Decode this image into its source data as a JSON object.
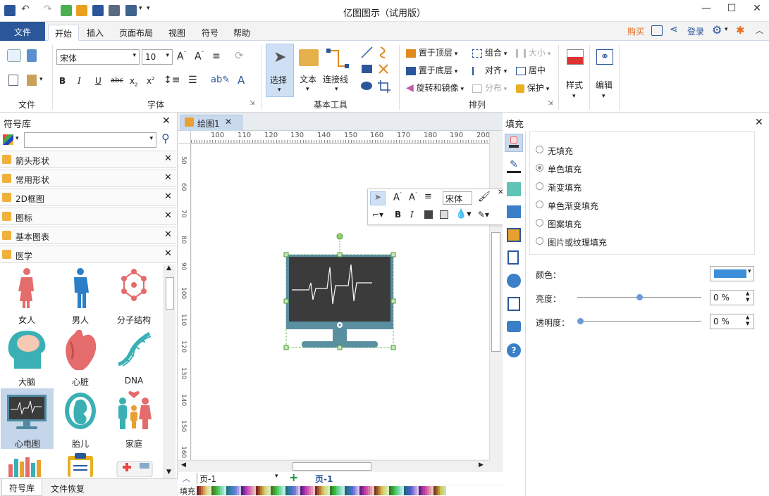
{
  "app": {
    "title": "亿图图示（试用版）"
  },
  "window_controls": {
    "min": "—",
    "max": "☐",
    "close": "✕"
  },
  "menu_tabs": [
    "开始",
    "插入",
    "页面布局",
    "视图",
    "符号",
    "帮助"
  ],
  "file_tab": "文件",
  "top_right": {
    "buy": "购买",
    "login": "登录"
  },
  "ribbon": {
    "groups": {
      "file": "文件",
      "font": "字体",
      "basic_tools": "基本工具",
      "arrange": "排列"
    },
    "font_name": "宋体",
    "font_size": "10",
    "tools": {
      "select": "选择",
      "text": "文本",
      "connector": "连接线"
    },
    "arrange": {
      "bring_front": "置于顶层",
      "send_back": "置于底层",
      "rotate_mirror": "旋转和镜像",
      "group": "组合",
      "align": "对齐",
      "distribute": "分布",
      "size": "大小",
      "center": "居中",
      "protect": "保护"
    },
    "style": "样式",
    "edit": "编辑"
  },
  "left_panel": {
    "title": "符号库",
    "search_placeholder": "",
    "libraries": [
      "箭头形状",
      "常用形状",
      "2D框图",
      "图标",
      "基本图表",
      "医学"
    ],
    "shapes": [
      "女人",
      "男人",
      "分子结构",
      "大脑",
      "心脏",
      "DNA",
      "心电图",
      "胎儿",
      "家庭"
    ],
    "bottom_tabs": [
      "符号库",
      "文件恢复"
    ]
  },
  "document": {
    "tab_label": "绘图1",
    "page_select": "页-1",
    "page_tab": "页-1",
    "fill_label": "填充",
    "ruler_h": [
      "100",
      "110",
      "120",
      "130",
      "140",
      "150",
      "160",
      "170",
      "180",
      "190",
      "200"
    ],
    "ruler_v": [
      "50",
      "60",
      "70",
      "80",
      "90",
      "100",
      "110",
      "120",
      "130",
      "140",
      "150",
      "160"
    ]
  },
  "float_toolbar": {
    "font": "宋体"
  },
  "right_panel": {
    "title": "填充",
    "options": [
      "无填充",
      "单色填充",
      "渐变填充",
      "单色渐变填充",
      "图案填充",
      "图片或纹理填充"
    ],
    "selected_option": "单色填充",
    "color_label": "颜色：",
    "color_value": "#3b8fd9",
    "brightness_label": "亮度：",
    "brightness_value": "0 %",
    "transparency_label": "透明度：",
    "transparency_value": "0 %"
  },
  "colors": {
    "accent": "#2b579a",
    "selection": "#6fbf5a",
    "monitor_bg": "#3b3b3b",
    "monitor_frame": "#5a8fa0"
  }
}
